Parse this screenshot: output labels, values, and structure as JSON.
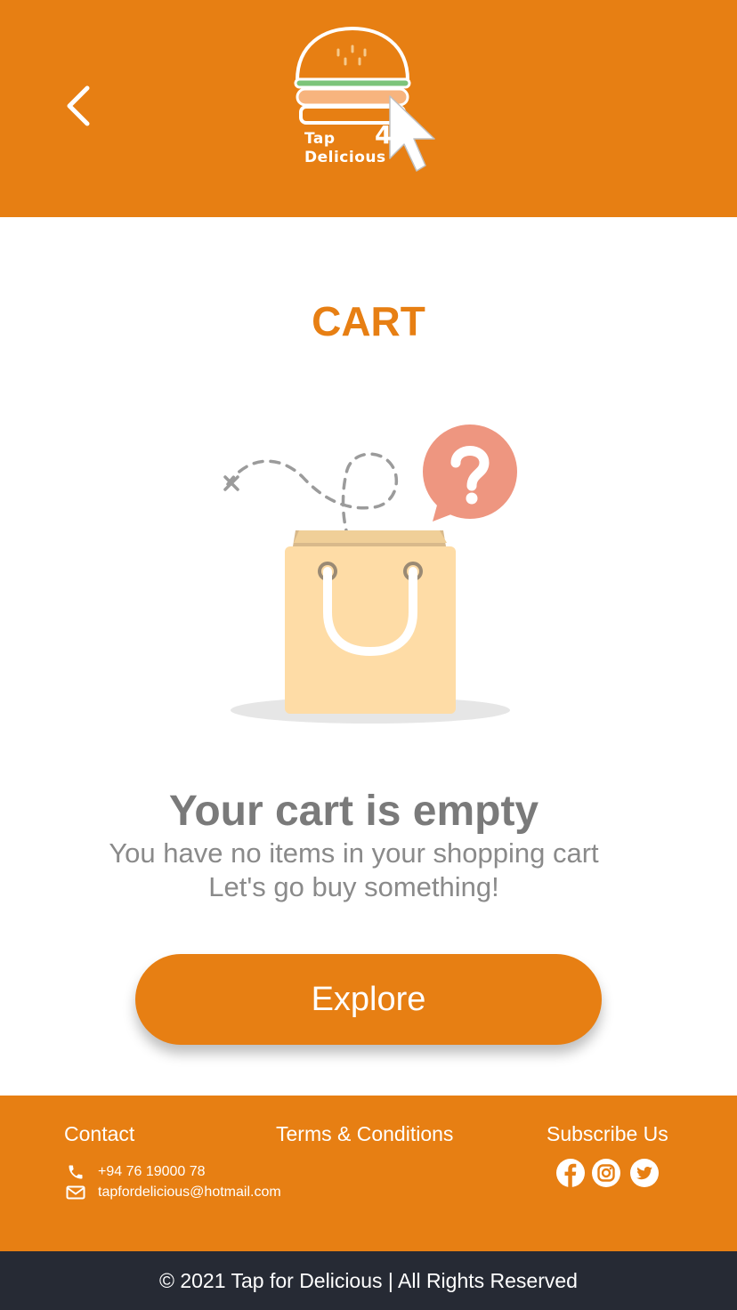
{
  "header": {
    "logo_text_line1": "Tap",
    "logo_text_line2": "Delicious",
    "logo_four": "4",
    "back_icon": "chevron-left-icon"
  },
  "page": {
    "title": "CART",
    "empty_heading": "Your cart is empty",
    "empty_line1": "You have no items in your shopping cart",
    "empty_line2": "Let's go buy something!",
    "explore_label": "Explore"
  },
  "footer": {
    "contact_title": "Contact",
    "phone": "+94 76 19000 78",
    "email": "tapfordelicious@hotmail.com",
    "terms_title": "Terms & Conditions",
    "subscribe_title": "Subscribe Us",
    "social_icons": [
      "facebook-icon",
      "instagram-icon",
      "twitter-icon"
    ],
    "copyright": "© 2021 Tap for Delicious | All Rights Reserved"
  },
  "colors": {
    "brand_orange": "#e77f13",
    "dark_bar": "#262a34",
    "text_gray": "#7a7a7a",
    "bag": "#fedca6",
    "question_bubble": "#ee9680"
  }
}
